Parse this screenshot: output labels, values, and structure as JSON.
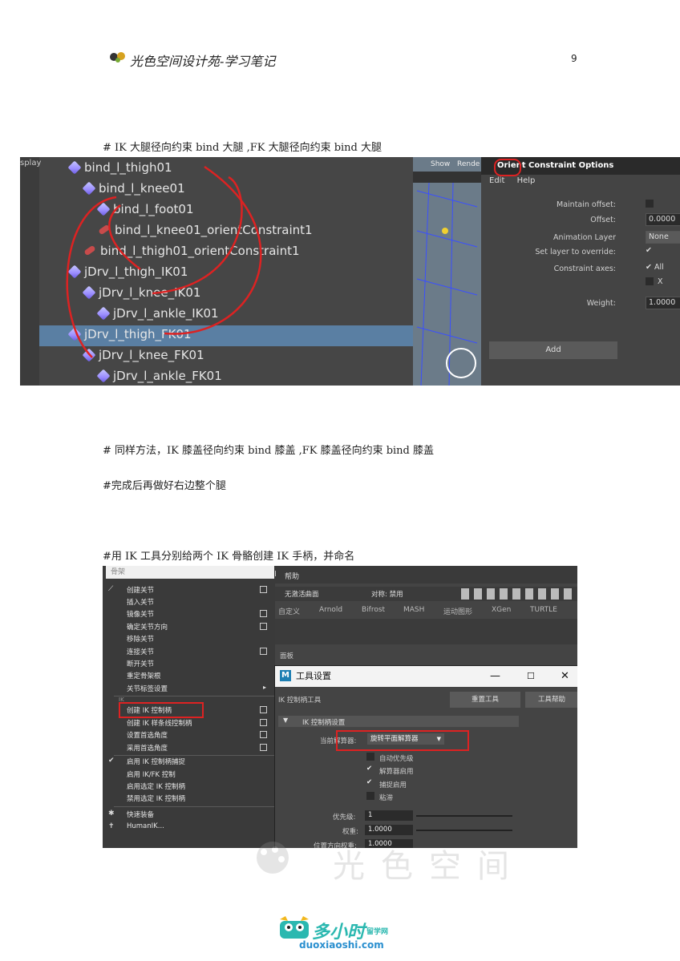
{
  "header": {
    "title": "光色空间设计苑-学习笔记",
    "page_number": "9"
  },
  "paragraphs": {
    "p1": "#     IK 大腿径向约束 bind 大腿 ,FK 大腿径向约束 bind 大腿",
    "p2": "#     同样方法，IK 膝盖径向约束 bind 膝盖 ,FK 膝盖径向约束 bind 膝盖",
    "p3": "#完成后再做好右边整个腿",
    "p4": "#用 IK 工具分别给两个 IK 骨骼创建 IK 手柄，并命名"
  },
  "outliner": {
    "left_label": "splay",
    "items": [
      {
        "label": "bind_l_thigh01",
        "icon": "joint-icon"
      },
      {
        "label": "bind_l_knee01",
        "icon": "joint-icon"
      },
      {
        "label": "bind_l_foot01",
        "icon": "joint-icon"
      },
      {
        "label": "bind_l_knee01_orientConstraint1",
        "icon": "constraint-icon"
      },
      {
        "label": "bind_l_thigh01_orientConstraint1",
        "icon": "constraint-icon"
      },
      {
        "label": "jDrv_l_thigh_IK01",
        "icon": "joint-icon"
      },
      {
        "label": "jDrv_l_knee_IK01",
        "icon": "joint-icon"
      },
      {
        "label": "jDrv_l_ankle_IK01",
        "icon": "joint-icon"
      },
      {
        "label": "jDrv_l_thigh_FK01",
        "icon": "joint-icon"
      },
      {
        "label": "jDrv_l_knee_FK01",
        "icon": "joint-icon"
      },
      {
        "label": "jDrv_l_ankle_FK01",
        "icon": "joint-icon"
      }
    ]
  },
  "viewport": {
    "menu_show": "Show",
    "menu_render": "Rende"
  },
  "orient_dialog": {
    "title": "Orient Constraint Options",
    "menu": [
      "Edit",
      "Help"
    ],
    "maintain_offset": "Maintain offset:",
    "offset": "Offset:",
    "offset_value": "0.0000",
    "animation_layer": "Animation Layer",
    "animation_layer_value": "None",
    "set_layer": "Set layer to override:",
    "constraint_axes": "Constraint axes:",
    "axis_all": "All",
    "axis_x": "X",
    "weight": "Weight:",
    "weight_value": "1.0000",
    "add_button": "Add"
  },
  "skeleton_menu": {
    "search_placeholder": "骨架",
    "items": [
      {
        "label": "创建关节",
        "box": true
      },
      {
        "label": "插入关节",
        "box": false
      },
      {
        "label": "镜像关节",
        "box": true
      },
      {
        "label": "确定关节方向",
        "box": true
      },
      {
        "label": "移除关节",
        "box": false
      },
      {
        "label": "连接关节",
        "box": true
      },
      {
        "label": "断开关节",
        "box": false
      },
      {
        "label": "重定骨架根",
        "box": false
      },
      {
        "label": "关节标签设置",
        "box": false
      }
    ],
    "ik_header": "IK",
    "ik_items": [
      {
        "label": "创建 IK 控制柄",
        "box": true
      },
      {
        "label": "创建 IK 样条线控制柄",
        "box": true
      },
      {
        "label": "设置首选角度",
        "box": true
      },
      {
        "label": "采用首选角度",
        "box": true
      }
    ],
    "ik_toggle_items": [
      {
        "label": "启用 IK 控制柄捕捉"
      },
      {
        "label": "启用 IK/FK 控制"
      },
      {
        "label": "启用选定 IK 控制柄"
      },
      {
        "label": "禁用选定 IK 控制柄"
      }
    ],
    "extra_items": [
      {
        "label": "快速装备"
      },
      {
        "label": "HumanIK..."
      }
    ]
  },
  "main_window": {
    "menu_d": "d",
    "menu_help": "帮助",
    "curve_dropdown": "无激活曲面",
    "symmetry": "对称: 禁用",
    "shelf_tabs": [
      "自定义",
      "Arnold",
      "Bifrost",
      "MASH",
      "运动图形",
      "XGen",
      "TURTLE"
    ],
    "panel_label": "面板"
  },
  "tool_settings": {
    "title": "工具设置",
    "tool_name": "IK 控制柄工具",
    "reset_button": "重置工具",
    "help_button": "工具帮助",
    "section": "IK 控制柄设置",
    "solver_label": "当前解算器:",
    "solver_value": "旋转平面解算器",
    "auto_priority": "自动优先级",
    "solver_enable": "解算器启用",
    "snap_enable": "捕捉启用",
    "sticky": "粘滞",
    "priority_label": "优先级:",
    "priority_value": "1",
    "weight_label": "权重:",
    "weight_value": "1.0000",
    "pos_weight_label": "位置方向权重:",
    "pos_weight_value": "1.0000"
  },
  "watermark": {
    "text": "光色空间"
  },
  "footer_logo": {
    "brand": "多小时",
    "tag": "留学网",
    "url": "duoxiaoshi.com"
  },
  "colors": {
    "red_annotation": "#dd2222",
    "selection": "#5a7fa3",
    "maya_dark": "#444444"
  }
}
